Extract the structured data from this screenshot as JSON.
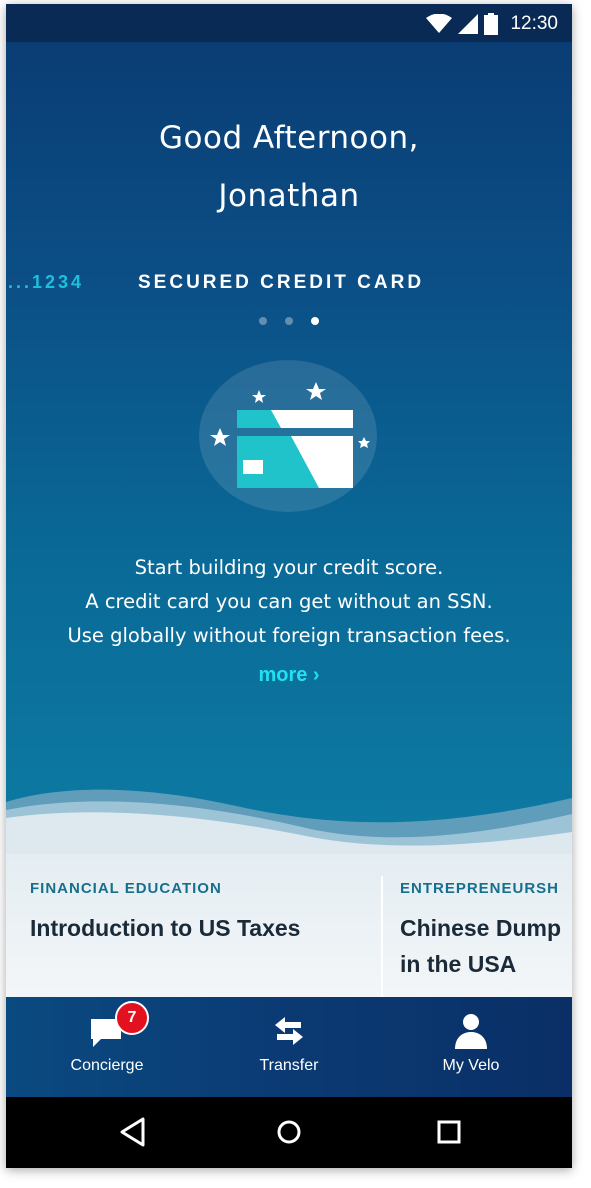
{
  "status_bar": {
    "time": "12:30",
    "icons": [
      "wifi-icon",
      "signal-icon",
      "battery-icon"
    ]
  },
  "hero": {
    "greeting_line1": "Good Afternoon,",
    "greeting_line2": "Jonathan",
    "previous_card_number": "...1234",
    "card_title": "SECURED CREDIT CARD",
    "pager": {
      "total": 3,
      "active_index": 2
    },
    "illustration": "credit-card-stars-icon",
    "description_lines": [
      "Start building your credit score.",
      "A credit card you can get without an SSN.",
      "Use globally without foreign transaction fees."
    ],
    "more_label": "more ›"
  },
  "articles": [
    {
      "category": "FINANCIAL EDUCATION",
      "title_lines": [
        "Introduction to US Taxes"
      ]
    },
    {
      "category": "ENTREPRENEURSH",
      "title_lines": [
        "Chinese Dump",
        "in the USA"
      ]
    }
  ],
  "bottom_nav": {
    "items": [
      {
        "label": "Concierge",
        "icon": "chat-icon",
        "badge": "7"
      },
      {
        "label": "Transfer",
        "icon": "transfer-arrows-icon"
      },
      {
        "label": "My Velo",
        "icon": "person-icon"
      }
    ]
  },
  "system_nav": {
    "icons": [
      "back-triangle-icon",
      "home-circle-icon",
      "recents-square-icon"
    ]
  },
  "colors": {
    "accent_cyan": "#21e0f0",
    "card_teal": "#1fc3c9",
    "category_teal": "#16708d",
    "badge_red": "#e3111f",
    "hero_top": "#0a3d74",
    "hero_bottom": "#0d7ba3"
  }
}
